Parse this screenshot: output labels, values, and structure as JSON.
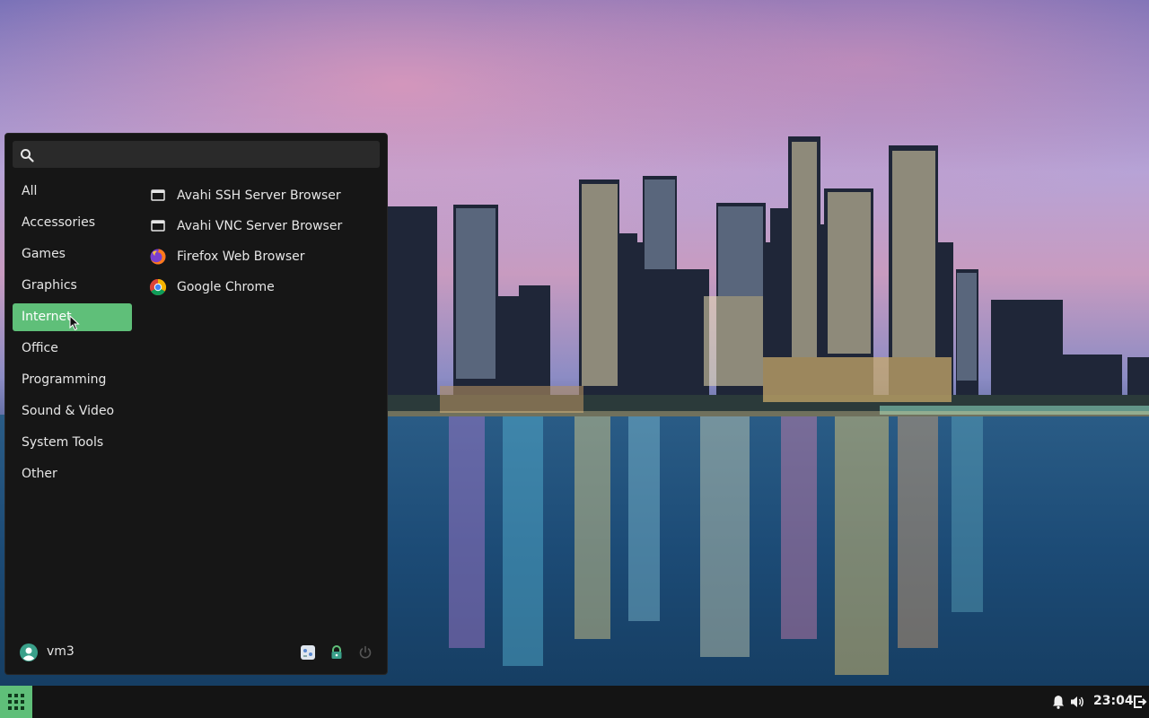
{
  "search": {
    "placeholder": "",
    "value": ""
  },
  "categories": [
    {
      "label": "All",
      "active": false
    },
    {
      "label": "Accessories",
      "active": false
    },
    {
      "label": "Games",
      "active": false
    },
    {
      "label": "Graphics",
      "active": false
    },
    {
      "label": "Internet",
      "active": true
    },
    {
      "label": "Office",
      "active": false
    },
    {
      "label": "Programming",
      "active": false
    },
    {
      "label": "Sound & Video",
      "active": false
    },
    {
      "label": "System Tools",
      "active": false
    },
    {
      "label": "Other",
      "active": false
    }
  ],
  "apps": [
    {
      "label": "Avahi SSH Server Browser",
      "icon": "network-window-icon"
    },
    {
      "label": "Avahi VNC Server Browser",
      "icon": "network-window-icon"
    },
    {
      "label": "Firefox Web Browser",
      "icon": "firefox-icon"
    },
    {
      "label": "Google Chrome",
      "icon": "chrome-icon"
    }
  ],
  "footer": {
    "user_name": "vm3",
    "buttons": [
      "settings-icon",
      "lock-icon",
      "power-icon"
    ]
  },
  "taskbar": {
    "clock": "23:04",
    "tray_icons": [
      "bell-icon",
      "volume-icon",
      "logout-icon"
    ]
  },
  "colors": {
    "accent": "#5fbf79",
    "menu_bg": "#161616",
    "taskbar_bg": "#141414"
  }
}
